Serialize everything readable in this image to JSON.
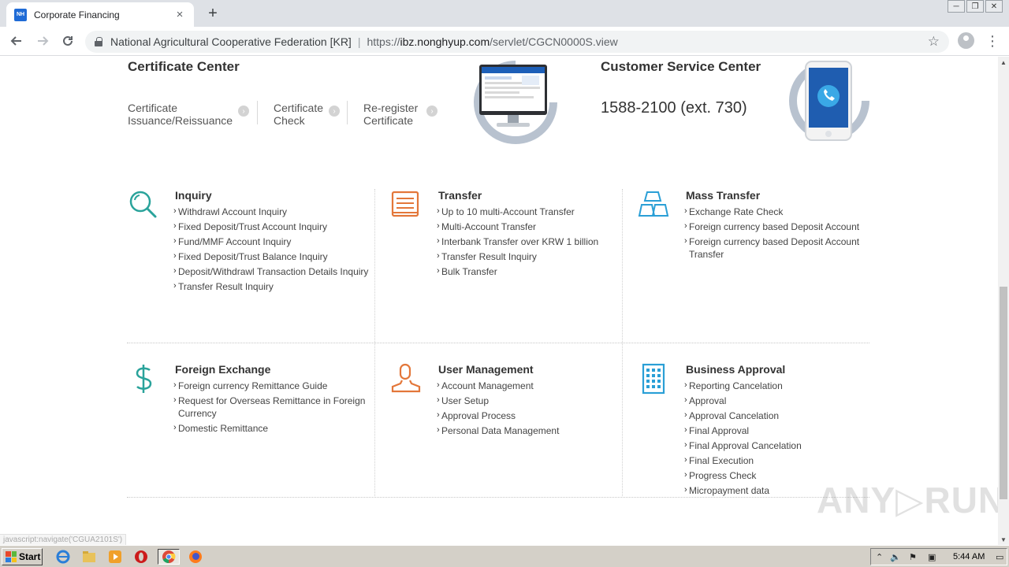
{
  "browser": {
    "tab_title": "Corporate Financing",
    "tab_favicon_text": "NH",
    "tab_close": "×",
    "new_tab": "+",
    "url_site_name": "National Agricultural Cooperative Federation [KR]",
    "url_scheme": "https://",
    "url_host": "ibz.nonghyup.com",
    "url_path": "/servlet/CGCN0000S.view",
    "window_minimize": "─",
    "window_restore": "❐",
    "window_close": "✕"
  },
  "certificate_center": {
    "title": "Certificate Center",
    "links": [
      {
        "label_line1": "Certificate",
        "label_line2": "Issuance/Reissuance"
      },
      {
        "label_line1": "Certificate",
        "label_line2": "Check"
      },
      {
        "label_line1": "Re-register",
        "label_line2": "Certificate"
      }
    ],
    "arrow": "›"
  },
  "customer_service": {
    "title": "Customer Service Center",
    "phone": "1588-2100 (ext. 730)"
  },
  "menus": [
    {
      "title": "Inquiry",
      "icon": "magnifier-icon",
      "items": [
        "Withdrawl Account Inquiry",
        "Fixed Deposit/Trust Account Inquiry",
        "Fund/MMF Account Inquiry",
        "Fixed Deposit/Trust Balance Inquiry",
        "Deposit/Withdrawl Transaction Details Inquiry",
        "Transfer Result Inquiry"
      ]
    },
    {
      "title": "Transfer",
      "icon": "document-tray-icon",
      "items": [
        "Up to 10 multi-Account Transfer",
        "Multi-Account Transfer",
        "Interbank Transfer over KRW 1 billion",
        "Transfer Result Inquiry",
        "Bulk Transfer"
      ]
    },
    {
      "title": "Mass Transfer",
      "icon": "gold-bars-icon",
      "items": [
        "Exchange Rate Check",
        "Foreign currency based Deposit Account",
        "Foreign currency based Deposit Account Transfer"
      ]
    },
    {
      "title": "Foreign Exchange",
      "icon": "dollar-icon",
      "items": [
        "Foreign currency Remittance Guide",
        "Request for Overseas Remittance in Foreign Currency",
        "Domestic Remittance"
      ]
    },
    {
      "title": "User Management",
      "icon": "user-icon",
      "items": [
        "Account Management",
        "User Setup",
        "Approval Process",
        "Personal Data Management"
      ]
    },
    {
      "title": "Business Approval",
      "icon": "building-icon",
      "items": [
        "Reporting Cancelation",
        "Approval",
        "Approval Cancelation",
        "Final Approval",
        "Final Approval Cancelation",
        "Final Execution",
        "Progress Check",
        "Micropayment data"
      ]
    }
  ],
  "status_bar_text": "javascript:navigate('CGUA2101S')",
  "watermark_text": "ANY▷RUN",
  "taskbar": {
    "start_label": "Start",
    "clock": "5:44 AM"
  },
  "colors": {
    "teal": "#2aa39b",
    "orange": "#e3773a",
    "blue": "#2a9fd6",
    "title_text": "#333333"
  }
}
